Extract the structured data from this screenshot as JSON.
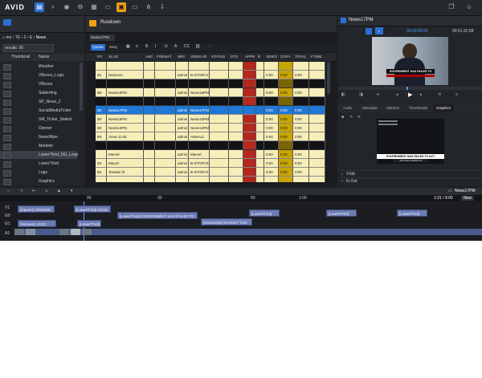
{
  "app": {
    "logo": "AVID"
  },
  "toolbar": {
    "icons": [
      "folder-icon",
      "search-icon",
      "browse-icon",
      "settings-icon",
      "layout-icon",
      "log-icon",
      "rundown-icon",
      "monitor-icon",
      "share-icon",
      "download-icon"
    ]
  },
  "left_panel": {
    "breadcrumb": [
      "mo",
      "TE",
      "2",
      "E",
      "News"
    ],
    "search_results": "results: 30",
    "columns": [
      "Thumbnail",
      "Name"
    ],
    "items": [
      "Weather",
      "VBoxes_Logic",
      "VBoxes",
      "Slatterfing",
      "SP_News_2",
      "SocialMediaTicker",
      "SM_Ticker_Statick",
      "Opener",
      "NewsWipe",
      "Markets",
      "LowerThird_DG_Loop",
      "LowerThird",
      "Logo",
      "Graphics"
    ],
    "selected_index": 10
  },
  "rundown": {
    "tab_label": "Rundown",
    "story_tab": "News17PM",
    "queue_label": "Queue",
    "story_label": "Story",
    "columns": [
      "PG",
      "SLUG",
      "ANC",
      "FORMAT",
      "WRI",
      "VIDEO-ID",
      "STATUS",
      "DTS",
      "APPR",
      "R",
      "VIDEO",
      "COPY",
      "TOTAL",
      "FTIME"
    ],
    "rows": [
      {
        "pg": "",
        "slug": "",
        "anc": "",
        "format": "",
        "wri": "",
        "vid": "",
        "video": "",
        "copy": "",
        "total": "",
        "type": "yellow"
      },
      {
        "pg": "B1",
        "slug": "beartoon",
        "anc": "",
        "format": "",
        "wri": "admin",
        "vid": "B-STORY1",
        "video": "0:00",
        "copy": "0:58",
        "total": "0:00",
        "type": "yellow"
      },
      {
        "pg": "",
        "slug": "",
        "anc": "",
        "format": "",
        "wri": "",
        "vid": "",
        "video": "",
        "copy": "",
        "total": "",
        "type": "black"
      },
      {
        "pg": "B0",
        "slug": "News16PM",
        "anc": "",
        "format": "",
        "wri": "admin",
        "vid": "News16PM",
        "video": "0:00",
        "copy": "0:00",
        "total": "0:00",
        "type": "yellow"
      },
      {
        "pg": "",
        "slug": "",
        "anc": "",
        "format": "",
        "wri": "",
        "vid": "",
        "video": "",
        "copy": "",
        "total": "",
        "type": "black"
      },
      {
        "pg": "B0",
        "slug": "News17PM",
        "anc": "",
        "format": "",
        "wri": "admin",
        "vid": "News17PM",
        "video": "0:00",
        "copy": "0:00",
        "total": "0:00",
        "type": "selected"
      },
      {
        "pg": "B0",
        "slug": "News15PM",
        "anc": "",
        "format": "",
        "wri": "admin",
        "vid": "News15PM",
        "video": "0:00",
        "copy": "0:00",
        "total": "0:00",
        "type": "yellow"
      },
      {
        "pg": "B0",
        "slug": "News14PM",
        "anc": "",
        "format": "",
        "wri": "admin",
        "vid": "News14PM",
        "video": "0:00",
        "copy": "0:00",
        "total": "0:00",
        "type": "yellow"
      },
      {
        "pg": "B0",
        "slug": "Anna 11.06",
        "anc": "",
        "format": "",
        "wri": "admin",
        "vid": "ANNA11",
        "video": "0:00",
        "copy": "0:00",
        "total": "0:00",
        "type": "yellow"
      },
      {
        "pg": "",
        "slug": "",
        "anc": "",
        "format": "",
        "wri": "",
        "vid": "",
        "video": "",
        "copy": "",
        "total": "",
        "type": "black"
      },
      {
        "pg": "",
        "slug": "Marvel",
        "anc": "",
        "format": "",
        "wri": "admin",
        "vid": "Marvel",
        "video": "0:00",
        "copy": "0:30",
        "total": "0:00",
        "type": "yellow"
      },
      {
        "pg": "B3",
        "slug": "MaryG",
        "anc": "",
        "format": "",
        "wri": "admin",
        "vid": "B-STORY3",
        "video": "0:00",
        "copy": "0:53",
        "total": "0:00",
        "type": "yellow"
      },
      {
        "pg": "B4",
        "slug": "Teeslas ift",
        "anc": "",
        "format": "",
        "wri": "admin",
        "vid": "B-STORY4",
        "video": "0:00",
        "copy": "0:00",
        "total": "0:00",
        "type": "yellow"
      },
      {
        "pg": "",
        "slug": "",
        "anc": "",
        "format": "",
        "wri": "",
        "vid": "",
        "video": "",
        "copy": "",
        "total": "",
        "type": "yellow"
      }
    ]
  },
  "monitor": {
    "title": "News17PM",
    "timecode_left": "00:00:00:00",
    "timecode_right": "00:01:31:58",
    "headline": "GOVERNMENT HAS FAILED TO ACT",
    "tabs": [
      "Audio",
      "Metadata",
      "Markers",
      "Thumbnails",
      "Graphics"
    ],
    "active_tab": "Graphics",
    "graphic_title": "GOVERNMENT HAS FAILED TO ACT",
    "graphic_sub": "JAN ANG PRESTON",
    "sections": [
      "VSdt",
      "In Out"
    ]
  },
  "timeline": {
    "title": "News17PM",
    "timecode": "1:31 / 9:00",
    "ruler": [
      "00",
      "30",
      "60",
      "1:00"
    ],
    "track_labels": [
      "V1",
      "G0",
      "G1",
      "A1"
    ],
    "clips": [
      {
        "label": "[Opener] OPENER"
      },
      {
        "label": "[LowerThird] GOVE"
      },
      {
        "label": "[LowerThird] GOVERNMENT HAS FAILED TO"
      },
      {
        "label": "[LowerThird]"
      },
      {
        "label": "[NewsWipe] MARKET TOD"
      },
      {
        "label": "[LowerThird]"
      },
      {
        "label": "[LowerThird]"
      },
      {
        "label": "[VBoxes] LOGO"
      },
      {
        "label": "[LowerThird]"
      }
    ],
    "new_label": "New"
  }
}
